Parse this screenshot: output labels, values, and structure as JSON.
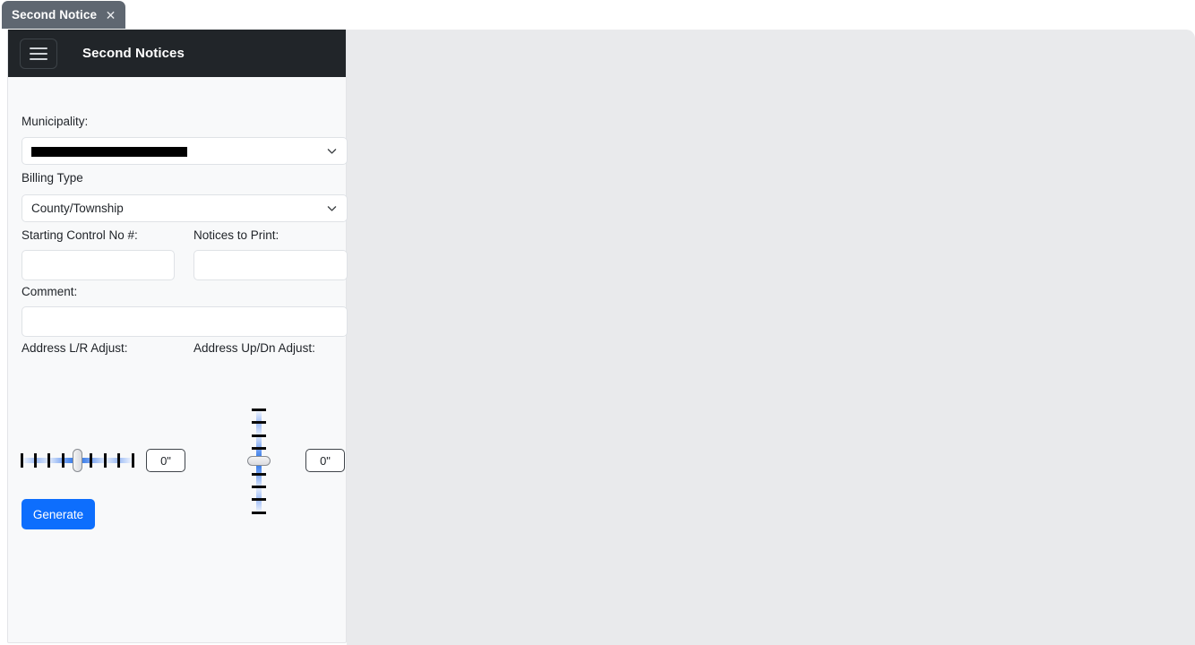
{
  "browser_tab": {
    "title": "Second Notice",
    "close_label": "✕"
  },
  "header": {
    "app_title": "Second Notices",
    "menu_icon": "hamburger-icon"
  },
  "form": {
    "municipality": {
      "label": "Municipality:",
      "value": "",
      "redacted": true
    },
    "billing_type": {
      "label": "Billing Type",
      "value": "County/Township"
    },
    "starting_control_no": {
      "label": "Starting Control No #:",
      "value": "",
      "placeholder": ""
    },
    "notices_to_print": {
      "label": "Notices to Print:",
      "value": "",
      "placeholder": ""
    },
    "comment": {
      "label": "Comment:",
      "value": "",
      "placeholder": ""
    },
    "address_lr_adjust": {
      "label": "Address L/R Adjust:",
      "value": "0\"",
      "ticks": 9,
      "position_percent": 50
    },
    "address_updn_adjust": {
      "label": "Address Up/Dn Adjust:",
      "value": "0\"",
      "ticks": 9,
      "position_percent": 50
    },
    "generate_button": {
      "label": "Generate"
    }
  },
  "colors": {
    "header_bg": "#212529",
    "tab_bg": "#5f6771",
    "panel_bg": "#f8f9fa",
    "canvas_bg": "#e9eaec",
    "accent": "#0d6efd",
    "slider_accent": "#1c6ae4"
  }
}
